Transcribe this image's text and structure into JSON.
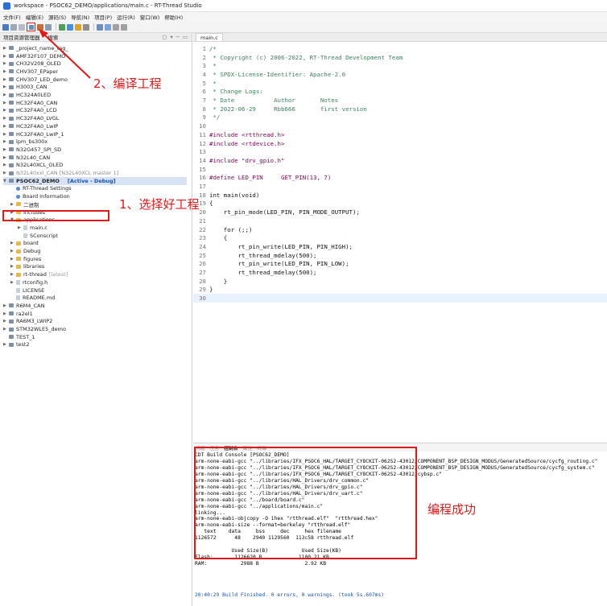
{
  "window": {
    "title": "workspace - PSOC62_DEMO/applications/main.c - RT-Thread Studio"
  },
  "menu": [
    "文件(F)",
    "编辑(E)",
    "源码(S)",
    "导航(N)",
    "项目(P)",
    "运行(R)",
    "窗口(W)",
    "帮助(H)"
  ],
  "explorer": {
    "tabs": [
      "项目资源管理器",
      "搜索"
    ],
    "items": [
      {
        "label": "_project_name_tag_",
        "kind": "project",
        "state": "closed"
      },
      {
        "label": "AMF32F107_DEMO",
        "kind": "project",
        "state": "closed"
      },
      {
        "label": "CH32V208_OLED",
        "kind": "project",
        "state": "closed"
      },
      {
        "label": "CHV307_EPaper",
        "kind": "project",
        "state": "closed"
      },
      {
        "label": "CHV307_LED_demo",
        "kind": "project",
        "state": "closed"
      },
      {
        "label": "H3003_CAN",
        "kind": "project",
        "state": "closed"
      },
      {
        "label": "HC324A0LED",
        "kind": "project",
        "state": "closed"
      },
      {
        "label": "HC32F4A0_CAN",
        "kind": "project",
        "state": "closed"
      },
      {
        "label": "HC32F4A0_LCD",
        "kind": "project",
        "state": "closed"
      },
      {
        "label": "HC32F4A0_LVGL",
        "kind": "project",
        "state": "closed"
      },
      {
        "label": "HC32F4A0_LwIP",
        "kind": "project",
        "state": "closed"
      },
      {
        "label": "HC32F4A0_LwIP_1",
        "kind": "project",
        "state": "closed"
      },
      {
        "label": "lpm_bs300x",
        "kind": "project",
        "state": "closed"
      },
      {
        "label": "N32G457_SPI_SD",
        "kind": "project",
        "state": "closed"
      },
      {
        "label": "N32L40_CAN",
        "kind": "project",
        "state": "closed"
      },
      {
        "label": "N32L40XCL_OLED",
        "kind": "project",
        "state": "closed"
      },
      {
        "label": "N32L40xxl_CAN [N32L40XCL master 1]",
        "kind": "project",
        "state": "closed",
        "grey": true
      },
      {
        "label": "PSOC62_DEMO",
        "kind": "project",
        "state": "open",
        "selected": true,
        "tag": "[Active - Debug]"
      },
      {
        "label": "RT-Thread Settings",
        "kind": "gear",
        "depth": 1
      },
      {
        "label": "Board Information",
        "kind": "gear",
        "depth": 1
      },
      {
        "label": "二进制",
        "kind": "folder",
        "depth": 1,
        "state": "closed"
      },
      {
        "label": "Includes",
        "kind": "folder",
        "depth": 1,
        "state": "closed"
      },
      {
        "label": "applications",
        "kind": "folder",
        "depth": 1,
        "state": "open"
      },
      {
        "label": "main.c",
        "kind": "file",
        "depth": 2,
        "state": "closed"
      },
      {
        "label": "SConscript",
        "kind": "file",
        "depth": 2
      },
      {
        "label": "board",
        "kind": "folder",
        "depth": 1,
        "state": "closed"
      },
      {
        "label": "Debug",
        "kind": "folder",
        "depth": 1,
        "state": "closed"
      },
      {
        "label": "figures",
        "kind": "folder",
        "depth": 1,
        "state": "closed"
      },
      {
        "label": "libraries",
        "kind": "folder",
        "depth": 1,
        "state": "closed"
      },
      {
        "label": "rt-thread",
        "kind": "folder",
        "depth": 1,
        "state": "closed",
        "tag": "[latest]"
      },
      {
        "label": "rtconfig.h",
        "kind": "file",
        "depth": 1,
        "state": "closed"
      },
      {
        "label": "LICENSE",
        "kind": "file",
        "depth": 1
      },
      {
        "label": "README.md",
        "kind": "file",
        "depth": 1
      },
      {
        "label": "R6M4_CAN",
        "kind": "project",
        "state": "closed"
      },
      {
        "label": "ra2el1",
        "kind": "project",
        "state": "closed"
      },
      {
        "label": "RA6M3_LWIP2",
        "kind": "project",
        "state": "closed"
      },
      {
        "label": "STM32WLE5_demo",
        "kind": "project",
        "state": "closed"
      },
      {
        "label": "TEST_1",
        "kind": "project"
      },
      {
        "label": "test2",
        "kind": "project",
        "state": "closed"
      }
    ]
  },
  "editor": {
    "tab": "main.c",
    "lines": [
      {
        "n": "1",
        "t": "/*",
        "c": "cmt"
      },
      {
        "n": "2",
        "t": " * Copyright (c) 2006-2022, RT-Thread Development Team",
        "c": "cmt"
      },
      {
        "n": "3",
        "t": " *",
        "c": "cmt"
      },
      {
        "n": "4",
        "t": " * SPDX-License-Identifier: Apache-2.0",
        "c": "cmt"
      },
      {
        "n": "5",
        "t": " *",
        "c": "cmt"
      },
      {
        "n": "6",
        "t": " * Change Logs:",
        "c": "cmt"
      },
      {
        "n": "7",
        "t": " * Date           Author       Notes",
        "c": "cmt"
      },
      {
        "n": "8",
        "t": " * 2022-06-29     Rbb666       first version",
        "c": "cmt"
      },
      {
        "n": "9",
        "t": " */",
        "c": "cmt"
      },
      {
        "n": "10",
        "t": "",
        "c": ""
      },
      {
        "n": "11",
        "t": "#include <rtthread.h>",
        "c": "pre"
      },
      {
        "n": "12",
        "t": "#include <rtdevice.h>",
        "c": "pre"
      },
      {
        "n": "13",
        "t": "",
        "c": ""
      },
      {
        "n": "14",
        "t": "#include \"drv_gpio.h\"",
        "c": "pre"
      },
      {
        "n": "15",
        "t": "",
        "c": ""
      },
      {
        "n": "16",
        "t": "#define LED_PIN     GET_PIN(13, 7)",
        "c": "pre"
      },
      {
        "n": "17",
        "t": "",
        "c": ""
      },
      {
        "n": "18",
        "t": "int main(void)",
        "c": ""
      },
      {
        "n": "19",
        "t": "{",
        "c": ""
      },
      {
        "n": "20",
        "t": "    rt_pin_mode(LED_PIN, PIN_MODE_OUTPUT);",
        "c": ""
      },
      {
        "n": "21",
        "t": "",
        "c": ""
      },
      {
        "n": "22",
        "t": "    for (;;)",
        "c": ""
      },
      {
        "n": "23",
        "t": "    {",
        "c": ""
      },
      {
        "n": "24",
        "t": "        rt_pin_write(LED_PIN, PIN_HIGH);",
        "c": ""
      },
      {
        "n": "25",
        "t": "        rt_thread_mdelay(500);",
        "c": ""
      },
      {
        "n": "26",
        "t": "        rt_pin_write(LED_PIN, PIN_LOW);",
        "c": ""
      },
      {
        "n": "27",
        "t": "        rt_thread_mdelay(500);",
        "c": ""
      },
      {
        "n": "28",
        "t": "    }",
        "c": ""
      },
      {
        "n": "29",
        "t": "}",
        "c": ""
      },
      {
        "n": "30",
        "t": "",
        "c": "cur"
      }
    ]
  },
  "console": {
    "tabs": [
      "问题",
      "任务",
      "控制台",
      "属性",
      "终端"
    ],
    "active_tab": "控制台",
    "lines": [
      "CDT Build Console [PSOC62_DEMO]",
      "arm-none-eabi-gcc \"../libraries/IFX_PSOC6_HAL/TARGET_CY8CKIT-062S2-43012/COMPONENT_BSP_DESIGN_MODUS/GeneratedSource/cycfg_routing.c\"",
      "arm-none-eabi-gcc \"../libraries/IFX_PSOC6_HAL/TARGET_CY8CKIT-062S2-43012/COMPONENT_BSP_DESIGN_MODUS/GeneratedSource/cycfg_system.c\"",
      "arm-none-eabi-gcc \"../libraries/IFX_PSOC6_HAL/TARGET_CY8CKIT-062S2-43012/cybsp.c\"",
      "arm-none-eabi-gcc \"../libraries/HAL_Drivers/drv_common.c\"",
      "arm-none-eabi-gcc \"../libraries/HAL_Drivers/drv_gpio.c\"",
      "arm-none-eabi-gcc \"../libraries/HAL_Drivers/drv_uart.c\"",
      "arm-none-eabi-gcc \"../board/board.c\"",
      "arm-none-eabi-gcc \"../applications/main.c\"",
      "linking...",
      "arm-none-eabi-objcopy -O ihex \"rtthread.elf\"  \"rtthread.hex\"",
      "arm-none-eabi-size --format=berkeley \"rtthread.elf\"",
      "   text    data     bss     dec     hex filename",
      "1126572      48    2940 1129560  113c58 rtthread.elf",
      "",
      "            Used Size(B)           Used Size(KB)",
      "Flash:       1126620 B            1100.21 KB",
      "RAM:           2988 B               2.92 KB"
    ],
    "footer": "20:40:29 Build Finished. 0 errors, 0 warnings. (took 5s.607ms)"
  },
  "annotations": {
    "step1": "1、选择好工程",
    "step2": "2、编译工程",
    "success": "编程成功",
    "color": "#e01818"
  }
}
